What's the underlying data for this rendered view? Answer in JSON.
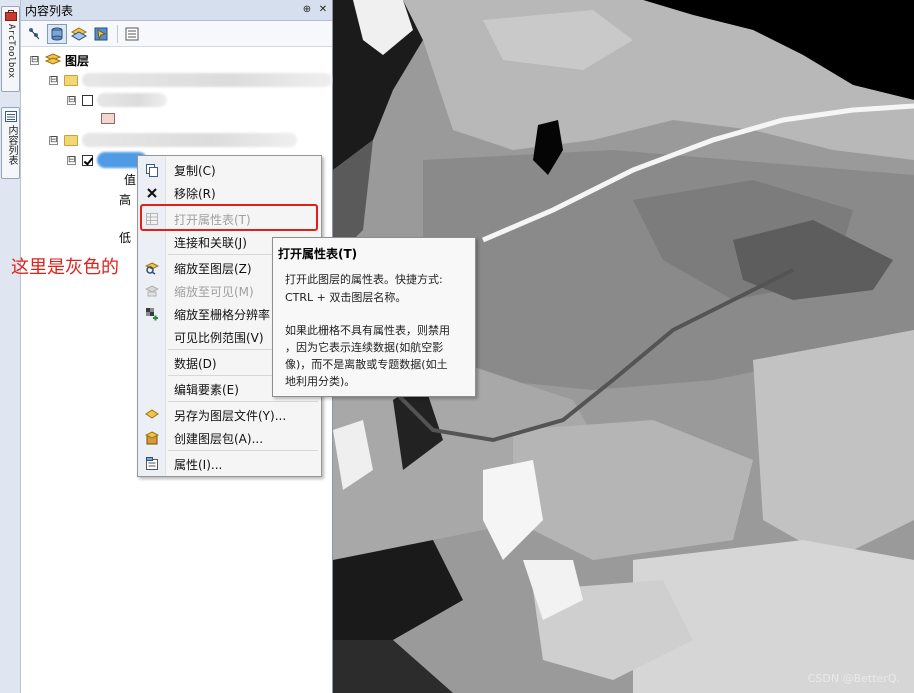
{
  "dock": {
    "arctoolbox_label": "ArcToolbox",
    "toc_tab_label": "内容列表"
  },
  "toc": {
    "title": "内容列表",
    "pin_glyph": "⊕",
    "close_glyph": "✕",
    "toolbar_icons": [
      "list-by-drawing-order-icon",
      "list-by-source-icon",
      "list-by-visibility-icon",
      "list-by-selection-icon",
      "options-icon"
    ],
    "root_label": "图层",
    "legend_value_label": "值",
    "legend_high_label": "高",
    "legend_low_label": "低",
    "expander_collapsed": "⊟"
  },
  "annotation": {
    "text": "这里是灰色的",
    "color": "#e0201b"
  },
  "context_menu": {
    "items": [
      {
        "label": "复制(C)",
        "icon": "copy-icon",
        "enabled": true
      },
      {
        "label": "移除(R)",
        "icon": "remove-icon",
        "enabled": true
      },
      {
        "label": "打开属性表(T)",
        "icon": "attribute-table-icon",
        "enabled": false
      },
      {
        "label": "连接和关联(J)",
        "icon": "",
        "enabled": true
      },
      {
        "label": "缩放至图层(Z)",
        "icon": "zoom-to-layer-icon",
        "enabled": true
      },
      {
        "label": "缩放至可见(M)",
        "icon": "zoom-to-visible-icon",
        "enabled": false
      },
      {
        "label": "缩放至栅格分辨率",
        "icon": "zoom-raster-resolution-icon",
        "enabled": true
      },
      {
        "label": "可见比例范围(V)",
        "icon": "",
        "enabled": true
      },
      {
        "label": "数据(D)",
        "icon": "",
        "enabled": true
      },
      {
        "label": "编辑要素(E)",
        "icon": "",
        "enabled": true
      },
      {
        "label": "另存为图层文件(Y)...",
        "icon": "save-layer-file-icon",
        "enabled": true
      },
      {
        "label": "创建图层包(A)...",
        "icon": "create-layer-package-icon",
        "enabled": true
      },
      {
        "label": "属性(I)...",
        "icon": "properties-icon",
        "enabled": true
      }
    ]
  },
  "tooltip": {
    "title": "打开属性表(T)",
    "lines": [
      "打开此图层的属性表。快捷方式:",
      "CTRL + 双击图层名称。",
      "",
      "如果此栅格不具有属性表，则禁用",
      "，因为它表示连续数据(如航空影",
      "像)，而不是离散或专题数据(如土",
      "地利用分类)。"
    ]
  },
  "map": {
    "watermark": "CSDN @BetterQ."
  }
}
